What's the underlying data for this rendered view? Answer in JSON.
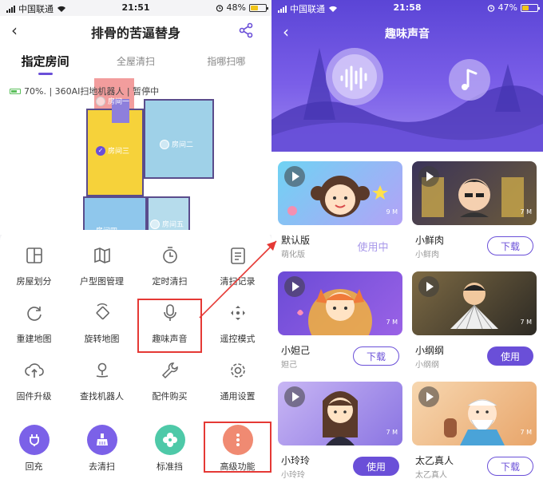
{
  "left": {
    "status": {
      "carrier": "中国联通",
      "time": "21:51",
      "battery": "48%"
    },
    "nav": {
      "title": "排骨的苦逼替身"
    },
    "tabs": [
      {
        "label": "指定房间",
        "active": true
      },
      {
        "label": "全屋清扫",
        "active": false
      },
      {
        "label": "指哪扫哪",
        "active": false
      }
    ],
    "map_status": "70%. | 360AI扫地机器人 | 暂停中",
    "rooms": {
      "r1": "房间一",
      "r2": "房间二",
      "r3": "房间三",
      "r4": "房间四",
      "r5": "房间五"
    },
    "grid": [
      {
        "label": "房屋划分",
        "icon": "split-icon"
      },
      {
        "label": "户型图管理",
        "icon": "map-icon"
      },
      {
        "label": "定时清扫",
        "icon": "timer-icon"
      },
      {
        "label": "清扫记录",
        "icon": "record-icon"
      },
      {
        "label": "重建地图",
        "icon": "rebuild-icon"
      },
      {
        "label": "旋转地图",
        "icon": "rotate-icon"
      },
      {
        "label": "趣味声音",
        "icon": "microphone-icon"
      },
      {
        "label": "遥控模式",
        "icon": "remote-icon"
      },
      {
        "label": "固件升级",
        "icon": "upload-icon"
      },
      {
        "label": "查找机器人",
        "icon": "locate-icon"
      },
      {
        "label": "配件购买",
        "icon": "wrench-icon"
      },
      {
        "label": "通用设置",
        "icon": "gear-icon"
      }
    ],
    "bottom": [
      {
        "label": "回充",
        "icon": "charge-icon",
        "color": "#7b61e8"
      },
      {
        "label": "去清扫",
        "icon": "broom-icon",
        "color": "#7b61e8"
      },
      {
        "label": "标准挡",
        "icon": "fan-icon",
        "color": "#4ec9a8"
      },
      {
        "label": "高级功能",
        "icon": "more-icon",
        "color": "#f08a72"
      }
    ]
  },
  "right": {
    "status": {
      "carrier": "中国联通",
      "time": "21:58",
      "battery": "47%"
    },
    "title": "趣味声音",
    "cards": [
      {
        "name": "默认版",
        "sub": "萌化版",
        "size": "9 M",
        "button": "使用中",
        "state": "inuse"
      },
      {
        "name": "小鲜肉",
        "sub": "小鲜肉",
        "size": "7 M",
        "button": "下载",
        "state": "download"
      },
      {
        "name": "小妲己",
        "sub": "妲己",
        "size": "7 M",
        "button": "下载",
        "state": "download"
      },
      {
        "name": "小纲纲",
        "sub": "小纲纲",
        "size": "7 M",
        "button": "使用",
        "state": "use"
      },
      {
        "name": "小玲玲",
        "sub": "小玲玲",
        "size": "7 M",
        "button": "使用",
        "state": "use"
      },
      {
        "name": "太乙真人",
        "sub": "太乙真人",
        "size": "7 M",
        "button": "下载",
        "state": "download"
      }
    ]
  }
}
